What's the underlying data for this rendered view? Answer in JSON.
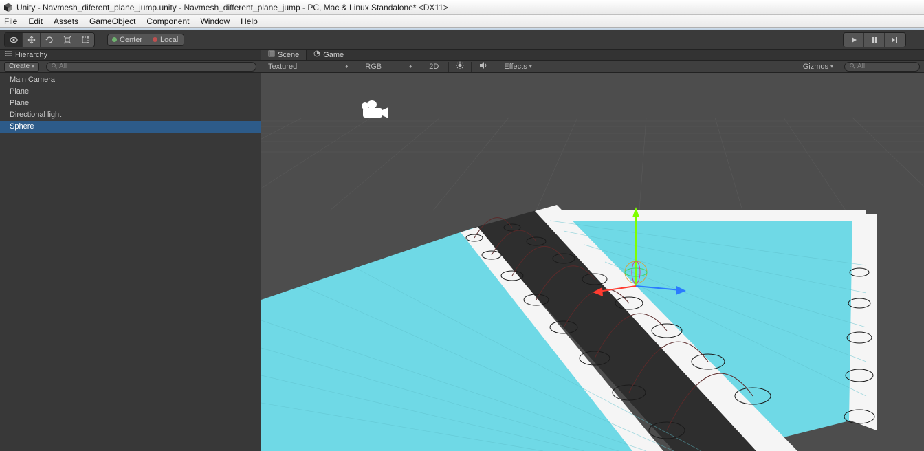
{
  "window": {
    "title": "Unity - Navmesh_diferent_plane_jump.unity - Navmesh_different_plane_jump - PC, Mac & Linux Standalone* <DX11>"
  },
  "menu": {
    "items": [
      "File",
      "Edit",
      "Assets",
      "GameObject",
      "Component",
      "Window",
      "Help"
    ]
  },
  "toolbar": {
    "pivot_center": "Center",
    "pivot_local": "Local"
  },
  "hierarchy": {
    "tab_label": "Hierarchy",
    "create_label": "Create",
    "search_placeholder": "All",
    "items": [
      {
        "label": "Main Camera",
        "selected": false
      },
      {
        "label": "Plane",
        "selected": false
      },
      {
        "label": "Plane",
        "selected": false
      },
      {
        "label": "Directional light",
        "selected": false
      },
      {
        "label": "Sphere",
        "selected": true
      }
    ]
  },
  "scene": {
    "tab_scene": "Scene",
    "tab_game": "Game",
    "shading": "Textured",
    "render_mode": "RGB",
    "view_2d": "2D",
    "effects": "Effects",
    "gizmos": "Gizmos",
    "search_placeholder": "All"
  }
}
